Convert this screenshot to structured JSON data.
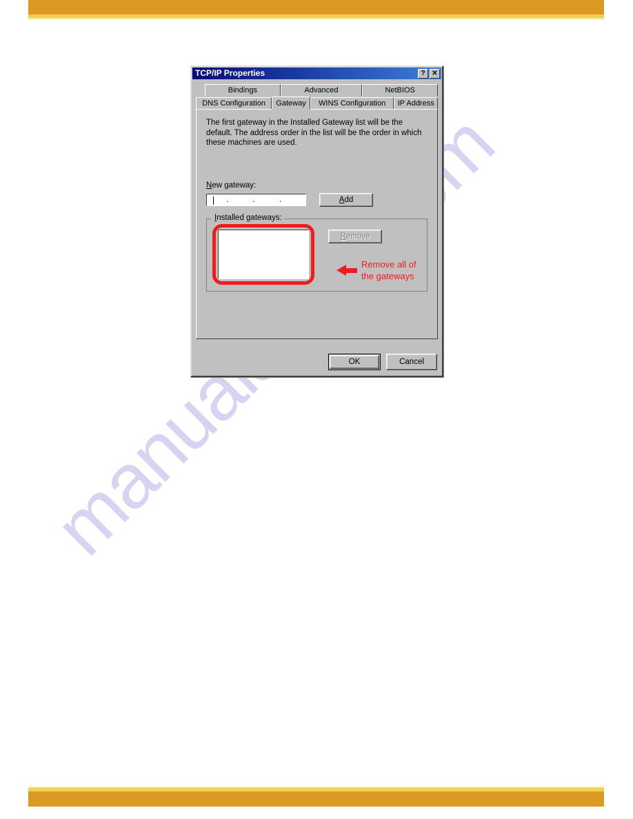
{
  "page": {
    "decor": {
      "bar_color": "#dd9a22",
      "bar_accent_color": "#f0d055"
    },
    "watermark": {
      "text": "manualshive.com",
      "color": "#c8c8ee"
    }
  },
  "dialog": {
    "title": "TCP/IP Properties",
    "title_buttons": {
      "help_label": "?",
      "close_label": "✕"
    },
    "tabs": {
      "row1": [
        {
          "label": "Bindings",
          "active": false
        },
        {
          "label": "Advanced",
          "active": false
        },
        {
          "label": "NetBIOS",
          "active": false
        }
      ],
      "row2": [
        {
          "label": "DNS Configuration",
          "active": false
        },
        {
          "label": "Gateway",
          "active": true
        },
        {
          "label": "WINS Configuration",
          "active": false
        },
        {
          "label": "IP Address",
          "active": false
        }
      ]
    },
    "panel": {
      "description": "The first gateway in the Installed Gateway list will be the default. The address order in the list will be the order in which these machines are used.",
      "new_gateway": {
        "label_accel": "N",
        "label_rest": "ew gateway:",
        "value": "",
        "dot": ".",
        "add_button": {
          "accel": "A",
          "rest": "dd"
        }
      },
      "installed_gateways": {
        "label_accel": "I",
        "label_rest": "nstalled gateways:",
        "list_items": [],
        "remove_button": {
          "accel": "R",
          "rest": "emove",
          "enabled": false
        },
        "annotation": {
          "line1": "Remove all of",
          "line2": "the gateways",
          "color": "#ee1c1c"
        },
        "highlight_color": "#ee1c1c"
      }
    },
    "footer": {
      "ok_label": "OK",
      "cancel_label": "Cancel"
    }
  }
}
